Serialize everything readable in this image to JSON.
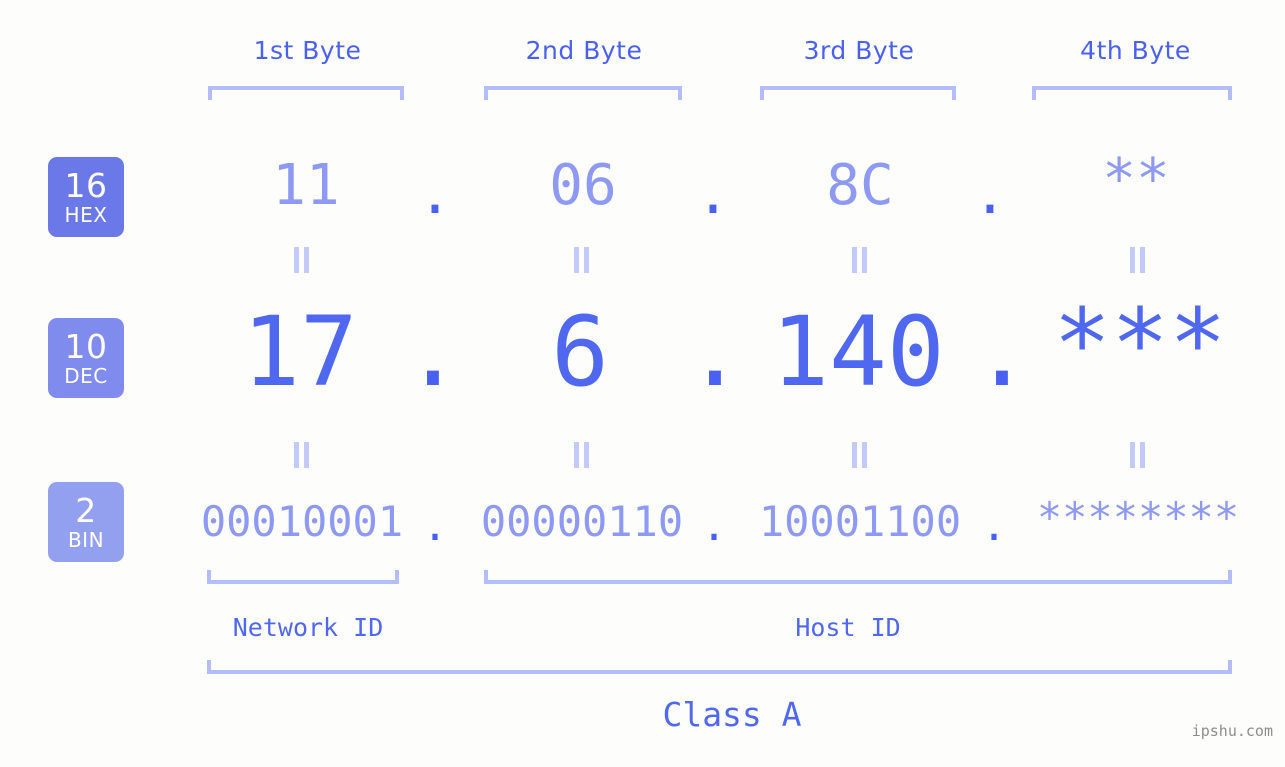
{
  "background_color": "#fdfefb",
  "accent_color": "#4a60f0",
  "muted_accent_color": "#8d99f2",
  "bracket_color": "#b4bdfb",
  "header": {
    "byte_labels": [
      {
        "text": "1st Byte"
      },
      {
        "text": "2nd Byte"
      },
      {
        "text": "3rd Byte"
      },
      {
        "text": "4th Byte"
      }
    ]
  },
  "bases": [
    {
      "id": "hex",
      "number": "16",
      "name": "HEX",
      "color": "#6b78e8"
    },
    {
      "id": "dec",
      "number": "10",
      "name": "DEC",
      "color": "#7f8ced"
    },
    {
      "id": "bin",
      "number": "2",
      "name": "BIN",
      "color": "#93a0f0"
    }
  ],
  "rows": {
    "hex": {
      "values": [
        "11",
        "06",
        "8C",
        "**"
      ],
      "separators": [
        ".",
        ".",
        "."
      ]
    },
    "dec": {
      "values": [
        "17",
        "6",
        "140",
        "***"
      ],
      "separators": [
        ".",
        ".",
        "."
      ]
    },
    "bin": {
      "values": [
        "00010001",
        "00000110",
        "10001100",
        "********"
      ],
      "separators": [
        ".",
        ".",
        "."
      ]
    }
  },
  "footer": {
    "network_id_label": "Network ID",
    "host_id_label": "Host ID",
    "class_label": "Class A",
    "watermark": "ipshu.com"
  }
}
